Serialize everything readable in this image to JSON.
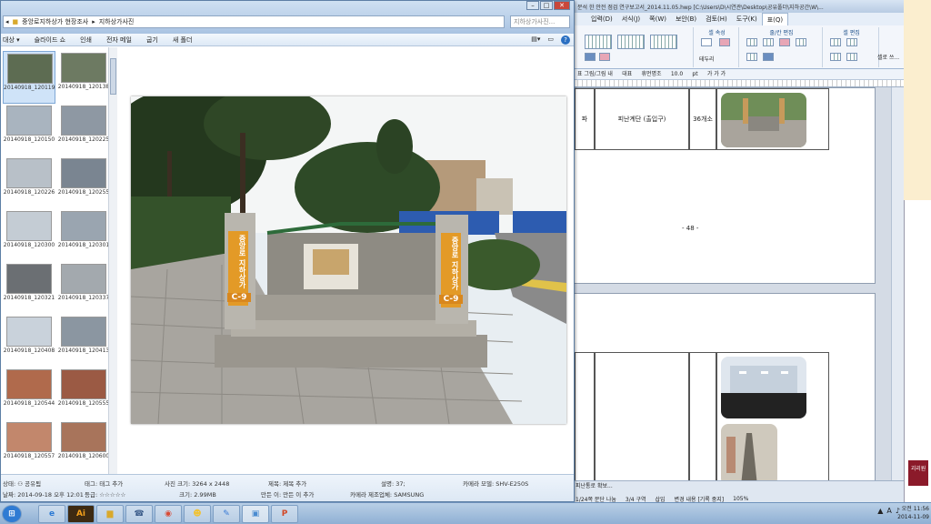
{
  "hwp": {
    "title": "분석 한 안전 점검 연구보고서_2014.11.05.hwp  [C:\\Users\\D\\시연관\\Desktop\\공유폴더\\지하공간\\W\\...",
    "menu": [
      "입력(D)",
      "서식(J)",
      "쪽(W)",
      "보안(B)",
      "검토(H)",
      "도구(K)",
      "표(Q)"
    ],
    "ribbon_groups": [
      "셀 속성",
      "줄/칸 편집",
      "셀 편집"
    ],
    "ribbon_labels": [
      "테두리",
      "셀로 쓰..."
    ],
    "format_bar": [
      "표 그림/그림 내",
      "대표",
      "휴먼명조",
      "10.0",
      "pt",
      "가 가 가"
    ],
    "table_row": {
      "col1": "파",
      "col2": "피난계단 (출입구)",
      "col3": "36개소"
    },
    "page_number": "- 48 -",
    "status_tabs": "피난통로 확보...",
    "status_info": [
      "1/24쪽 문단 나눔",
      "3/4 구역",
      "삽입",
      "변경 내용 [기록 중지]",
      "105%"
    ]
  },
  "rightstrip": {
    "badge": "괴리원",
    "clock_time": "오전 11:56",
    "clock_date": "2014-11-09"
  },
  "viewer": {
    "address": [
      "중앙로지하상가 현장조사",
      "지하상가사진"
    ],
    "search_placeholder": "지하상가사진...",
    "toolbar": [
      "대상 ▾",
      "슬라이드 쇼",
      "인쇄",
      "전자 메일",
      "굽기",
      "새 폴더"
    ],
    "thumbnails": [
      {
        "label": "20140918_120119",
        "selected": true
      },
      {
        "label": "20140918_120138",
        "selected": false
      },
      {
        "label": "20140918_120150",
        "selected": false
      },
      {
        "label": "20140918_120225",
        "selected": false
      },
      {
        "label": "20140918_120226",
        "selected": false
      },
      {
        "label": "20140918_120255",
        "selected": false
      },
      {
        "label": "20140918_120300",
        "selected": false
      },
      {
        "label": "20140918_120301",
        "selected": false
      },
      {
        "label": "20140918_120321",
        "selected": false
      },
      {
        "label": "20140918_120337",
        "selected": false
      },
      {
        "label": "20140918_120408",
        "selected": false
      },
      {
        "label": "20140918_120413",
        "selected": false
      },
      {
        "label": "20140918_120544",
        "selected": false
      },
      {
        "label": "20140918_120555",
        "selected": false
      },
      {
        "label": "20140918_120557",
        "selected": false
      },
      {
        "label": "20140918_120600",
        "selected": false
      }
    ],
    "photo_sign_text": "중앙로 지하상가",
    "photo_sign_code": "C-9",
    "details": {
      "author_label": "상태:",
      "author_value": "공유됨",
      "date_label": "날짜:",
      "date_value": "2014-09-18 오후 12:01",
      "tags_label": "태그:",
      "tags_value": "태그 추가",
      "rating_label": "등급:",
      "rating_value": "☆☆☆☆☆",
      "size_label": "사진 크기:",
      "size_value": "3264 x 2448",
      "filesize_label": "크기:",
      "filesize_value": "2.99MB",
      "title_label": "제목:",
      "title_value": "제목 추가",
      "creator_label": "만든 이:",
      "creator_value": "만든 이 추가",
      "comment_label": "설명:",
      "comment_value": "37;",
      "maker_label": "카메라 제조업체:",
      "maker_value": "SAMSUNG",
      "model_label": "카메라 모델:",
      "model_value": "SHV-E250S"
    }
  },
  "taskbar": {
    "apps": [
      "start",
      "ie",
      "illustrator",
      "explorer",
      "photoshop",
      "chrome",
      "messenger",
      "hwp",
      "viewer",
      "powerpoint"
    ],
    "ai_label": "Ai",
    "tray_lang": "A",
    "tray_time": "오전 11:56",
    "tray_date": "2014-11-09"
  }
}
